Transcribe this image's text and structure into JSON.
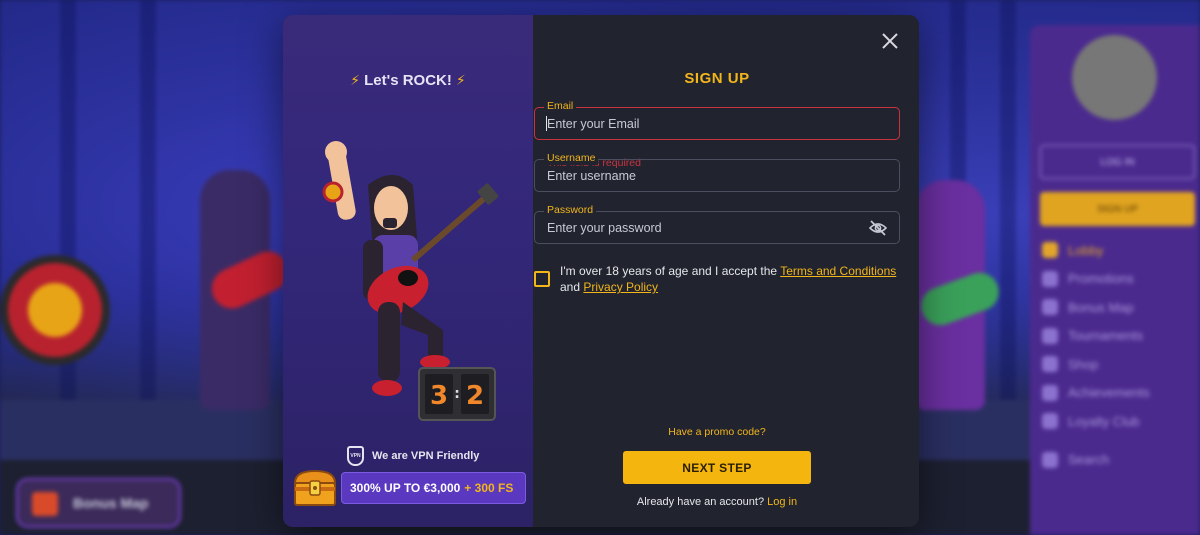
{
  "background": {
    "bonus_map_label": "Bonus Map",
    "login_label": "LOG IN",
    "signup_label": "SIGN UP",
    "menu_items": [
      "Lobby",
      "Promotions",
      "Bonus Map",
      "Tournaments",
      "Shop",
      "Achievements",
      "Loyalty Club",
      "Search"
    ]
  },
  "promo": {
    "title": "Let's ROCK!",
    "score_left": "3",
    "score_right": "2",
    "vpn_icon_text": "VPN",
    "vpn_text": "We are VPN Friendly",
    "bonus_main": "300% UP TO €3,000",
    "bonus_fs": "+ 300 FS"
  },
  "form": {
    "title": "SIGN UP",
    "email": {
      "label": "Email",
      "placeholder": "Enter your Email",
      "value": "",
      "error": "This field is required"
    },
    "username": {
      "label": "Username",
      "placeholder": "Enter username",
      "value": ""
    },
    "password": {
      "label": "Password",
      "placeholder": "Enter your password",
      "value": ""
    },
    "consent": {
      "prefix": "I'm over 18 years of age and I accept the ",
      "terms_link": "Terms and Conditions ",
      "middle": "and ",
      "privacy_link": "Privacy Policy"
    },
    "promo_code_link": "Have a promo code?",
    "next_button": "NEXT STEP",
    "account_prefix": "Already have an account? ",
    "login_link": "Log in"
  },
  "colors": {
    "accent": "#f2b51a",
    "error": "#c9343f",
    "modal_bg": "#21242f",
    "promo_bg": "#33277a"
  }
}
